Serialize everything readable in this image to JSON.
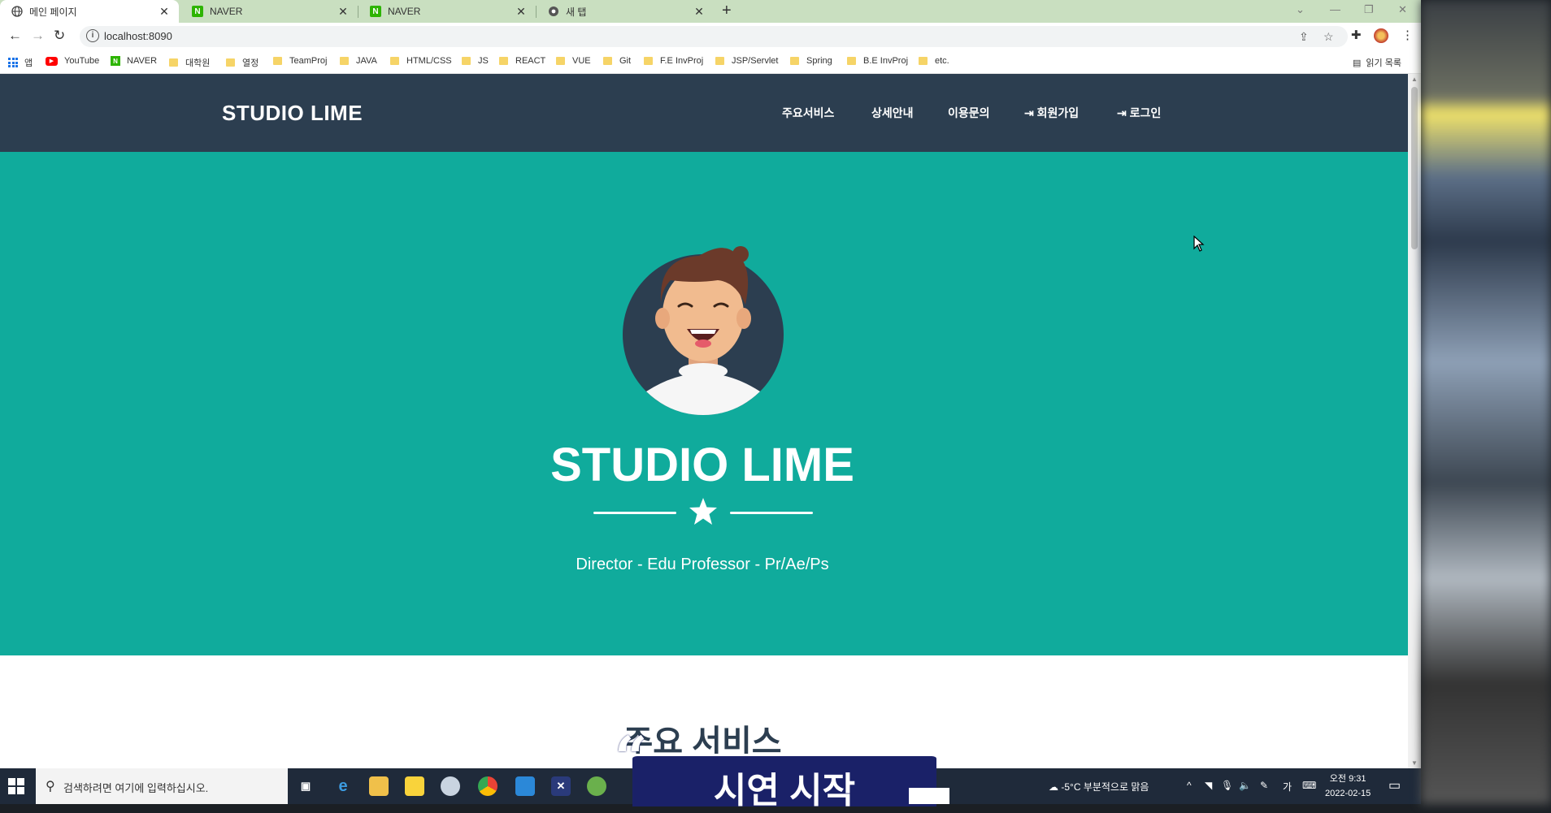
{
  "browser": {
    "tabs": [
      {
        "label": "메인 페이지",
        "active": true
      },
      {
        "label": "NAVER",
        "active": false
      },
      {
        "label": "NAVER",
        "active": false
      },
      {
        "label": "새 탭",
        "active": false
      }
    ],
    "new_tab": "+",
    "url": "localhost:8090",
    "bookmarks": [
      "앱",
      "YouTube",
      "NAVER",
      "대학원",
      "열정",
      "TeamProj",
      "JAVA",
      "HTML/CSS",
      "JS",
      "REACT",
      "VUE",
      "Git",
      "F.E InvProj",
      "JSP/Servlet",
      "Spring",
      "B.E InvProj",
      "etc."
    ],
    "reading_list": "읽기 목록"
  },
  "page": {
    "brand": "STUDIO LIME",
    "menu": [
      "주요서비스",
      "상세안내",
      "이용문의",
      "회원가입",
      "로그인"
    ],
    "hero_title": "STUDIO LIME",
    "hero_subtitle": "Director - Edu Professor - Pr/Ae/Ps",
    "section_title": "주요 서비스",
    "colors": {
      "nav": "#2c3e50",
      "hero": "#10ab9c"
    }
  },
  "taskbar": {
    "search_placeholder": "검색하려면 여기에 입력하십시오.",
    "weather": "-5°C  부분적으로 맑음",
    "ime": "가",
    "time": "오전 9:31",
    "date": "2022-02-15"
  },
  "overlay": {
    "caption": "시연 시작"
  }
}
